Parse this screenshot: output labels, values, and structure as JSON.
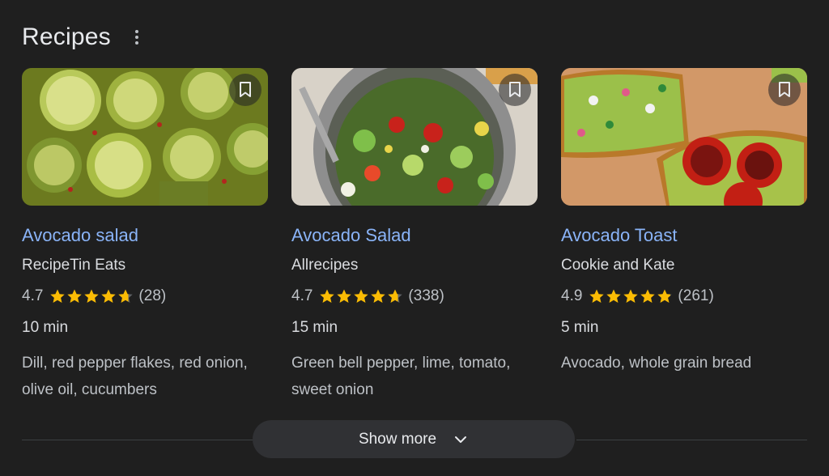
{
  "section": {
    "title": "Recipes",
    "menu_icon": "more-vert-icon"
  },
  "cards": [
    {
      "title": "Avocado salad",
      "source": "RecipeTin Eats",
      "rating": 4.7,
      "rating_text": "4.7",
      "reviews": "(28)",
      "time": "10 min",
      "ingredients": "Dill, red pepper flakes, red onion, olive oil, cucumbers",
      "bookmark_icon": "bookmark-icon"
    },
    {
      "title": "Avocado Salad",
      "source": "Allrecipes",
      "rating": 4.7,
      "rating_text": "4.7",
      "reviews": "(338)",
      "time": "15 min",
      "ingredients": "Green bell pepper, lime, tomato, sweet onion",
      "bookmark_icon": "bookmark-icon"
    },
    {
      "title": "Avocado Toast",
      "source": "Cookie and Kate",
      "rating": 4.9,
      "rating_text": "4.9",
      "reviews": "(261)",
      "time": "5 min",
      "ingredients": "Avocado, whole grain bread",
      "bookmark_icon": "bookmark-icon"
    }
  ],
  "show_more": {
    "label": "Show more",
    "icon": "chevron-down-icon"
  },
  "colors": {
    "background": "#1f1f1f",
    "link": "#8ab4f8",
    "star": "#fbbc04",
    "button": "#303134"
  }
}
